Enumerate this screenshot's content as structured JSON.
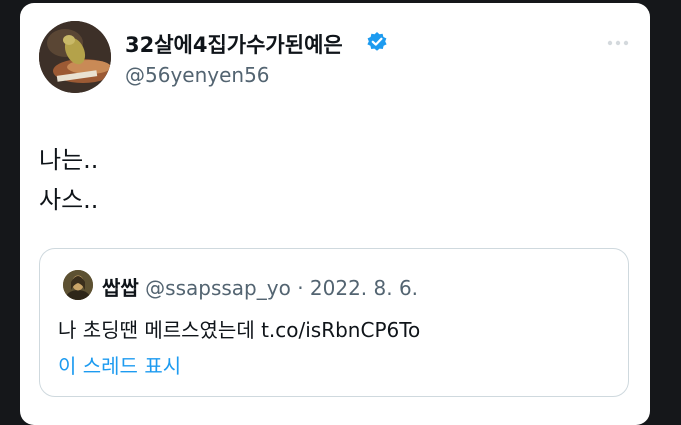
{
  "tweet": {
    "author": {
      "display_name": "32살에4집가수가된예은",
      "handle": "@56yenyen56",
      "verified_icon": "verified-badge-icon",
      "avatar": "avatar-painting"
    },
    "more_icon": "more-options-icon",
    "lines": [
      "나는..",
      "사스.."
    ],
    "quote": {
      "author_name": "쌉쌉",
      "handle": "@ssapssap_yo",
      "separator": "·",
      "date": "2022. 8. 6.",
      "text": "나 초딩땐 메르스였는데 t.co/isRbnCP6To",
      "show_thread": "이 스레드 표시"
    }
  },
  "colors": {
    "background": "#15171a",
    "card": "#ffffff",
    "text_primary": "#0f1419",
    "text_secondary": "#536471",
    "accent": "#1d9bf0",
    "border": "#cfd9de"
  }
}
